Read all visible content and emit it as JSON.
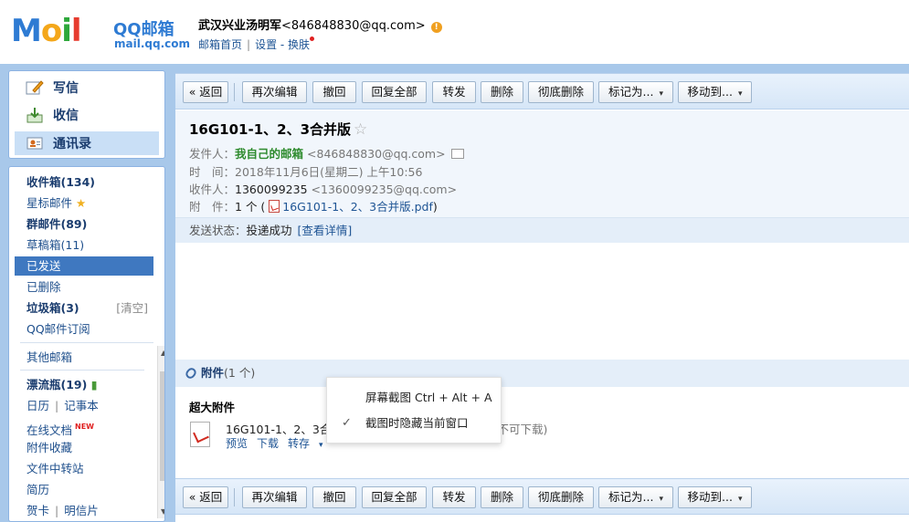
{
  "header": {
    "logo_text": "MOil",
    "brand": "QQ邮箱",
    "domain": "mail.qq.com",
    "user_name": "武汉兴业汤明军",
    "user_email": "<846848830@qq.com>",
    "warn_icon": "!",
    "links": [
      "邮箱首页",
      "设置",
      "换肤"
    ]
  },
  "sidebar": {
    "actions": [
      {
        "label": "写信",
        "icon": "pencil-icon"
      },
      {
        "label": "收信",
        "icon": "inbox-icon"
      },
      {
        "label": "通讯录",
        "icon": "contacts-icon"
      }
    ],
    "folders": [
      {
        "label": "收件箱(134)"
      },
      {
        "label": "星标邮件",
        "icon": "star-icon",
        "icon_glyph": "★"
      },
      {
        "label": "群邮件(89)"
      },
      {
        "label": "草稿箱(11)"
      },
      {
        "label": "已发送",
        "selected": true
      },
      {
        "label": "已删除"
      },
      {
        "label": "垃圾箱(3)",
        "extra": "[清空]"
      },
      {
        "label": "QQ邮件订阅"
      }
    ],
    "other": {
      "other_mail": "其他邮箱",
      "drift_bottle": "漂流瓶(19)",
      "calendar": "日历",
      "notes": "记事本",
      "online_docs": "在线文档",
      "new_badge": "NEW",
      "attach_fav": "附件收藏",
      "file_transfer": "文件中转站",
      "resume": "简历",
      "card": "贺卡",
      "postcard": "明信片",
      "sep": "|"
    }
  },
  "toolbar": {
    "back": "« 返回",
    "reedit": "再次编辑",
    "recall": "撤回",
    "reply_all": "回复全部",
    "forward": "转发",
    "delete": "删除",
    "delete_perm": "彻底删除",
    "mark_as": "标记为...",
    "move_to": "移动到...",
    "caret": "▾"
  },
  "mail": {
    "subject": "16G101-1、2、3合并版",
    "star": "☆",
    "sender_label": "发件人：",
    "sender_name": "我自己的邮箱",
    "sender_email": "<846848830@qq.com>",
    "time_label": "时　间：",
    "time_value": "2018年11月6日(星期二) 上午10:56",
    "to_label": "收件人：",
    "to_name": "1360099235",
    "to_email": "<1360099235@qq.com>",
    "attach_label": "附　件：",
    "attach_count": "1 个 (",
    "attach_file": "16G101-1、2、3合并版.pdf",
    "attach_close": ")",
    "status_label": "发送状态：",
    "status_value": "投递成功",
    "status_link": "[查看详情]"
  },
  "attachments": {
    "title": "附件",
    "count": "(1 个)",
    "big_title": "超大附件",
    "file_name": "16G101-1、2、3合",
    "file_note": "吾不可下载)",
    "actions": [
      "预览",
      "下载",
      "转存"
    ],
    "caret": "▾"
  },
  "popup": {
    "items": [
      {
        "label": "屏幕截图 Ctrl + Alt + A",
        "checked": false
      },
      {
        "label": "截图时隐藏当前窗口",
        "checked": true,
        "check_glyph": "✓"
      }
    ]
  },
  "scrollbar": {
    "up": "▲",
    "down": "▼"
  }
}
